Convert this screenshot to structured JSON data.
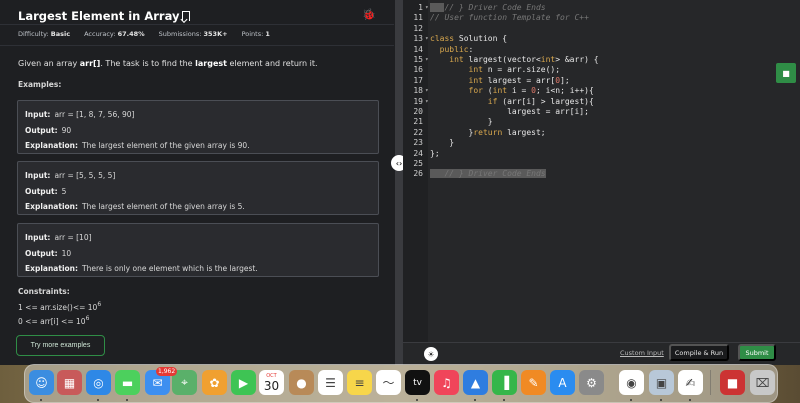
{
  "problem": {
    "title": "Largest Element in Array",
    "meta": [
      {
        "label": "Difficulty:",
        "value": "Basic"
      },
      {
        "label": "Accuracy:",
        "value": "67.48%"
      },
      {
        "label": "Submissions:",
        "value": "353K+"
      },
      {
        "label": "Points:",
        "value": "1"
      }
    ],
    "desc_pre": "Given an array ",
    "desc_arr": "arr[]",
    "desc_mid": ". The task is to find the ",
    "desc_bold": "largest",
    "desc_post": " element and return it.",
    "examples_heading": "Examples:",
    "input_label": "Input:",
    "output_label": "Output:",
    "explanation_label": "Explanation:",
    "examples": [
      {
        "input": "arr = [1, 8, 7, 56, 90]",
        "output": "90",
        "explanation": "The largest element of the given array is 90."
      },
      {
        "input": "arr = [5, 5, 5, 5]",
        "output": "5",
        "explanation": "The largest element of the given array is 5."
      },
      {
        "input": "arr = [10]",
        "output": "10",
        "explanation": "There is only one element which is the largest."
      }
    ],
    "constraints_heading": "Constraints:",
    "constraints": [
      {
        "text": "1 <= arr.size()<= 10",
        "sup": "6"
      },
      {
        "text": "0 <= arr[i] <= 10",
        "sup": "6"
      }
    ],
    "try_more_label": "Try more examples"
  },
  "editor": {
    "lines": [
      {
        "n": "1",
        "fold": true,
        "html": "<span class='hl'>   </span><span class='cm'>// } Driver Code Ends</span>"
      },
      {
        "n": "11",
        "fold": false,
        "html": "<span class='cm'>// User function Template for C++</span>"
      },
      {
        "n": "12",
        "fold": false,
        "html": ""
      },
      {
        "n": "13",
        "fold": true,
        "html": "<span class='kw'>class</span> Solution {"
      },
      {
        "n": "14",
        "fold": false,
        "html": "  <span class='kw'>public</span>:"
      },
      {
        "n": "15",
        "fold": true,
        "html": "    <span class='ty'>int</span> largest(vector&lt;<span class='ty'>int</span>&gt; &amp;arr) {"
      },
      {
        "n": "16",
        "fold": false,
        "html": "        <span class='ty'>int</span> n = arr.size();"
      },
      {
        "n": "17",
        "fold": false,
        "html": "        <span class='ty'>int</span> largest = arr[<span class='num'>0</span>];"
      },
      {
        "n": "18",
        "fold": true,
        "html": "        <span class='kw'>for</span> (<span class='ty'>int</span> i = <span class='num'>0</span>; i&lt;n; i++){"
      },
      {
        "n": "19",
        "fold": true,
        "html": "            <span class='kw'>if</span> (arr[i] &gt; largest){"
      },
      {
        "n": "20",
        "fold": false,
        "html": "                largest = arr[i];"
      },
      {
        "n": "21",
        "fold": false,
        "html": "            }"
      },
      {
        "n": "22",
        "fold": false,
        "html": "        }<span class='kw'>return</span> largest;"
      },
      {
        "n": "23",
        "fold": false,
        "html": "    }"
      },
      {
        "n": "24",
        "fold": false,
        "html": "};"
      },
      {
        "n": "25",
        "fold": false,
        "html": ""
      },
      {
        "n": "26",
        "fold": false,
        "html": "<span class='hl'>   </span><span class='cm hl'>// } Driver Code Ends</span>"
      }
    ],
    "custom_input_label": "Custom Input",
    "compile_label": "Compile & Run",
    "submit_label": "Submit"
  },
  "dock": {
    "mail_badge": "1,962",
    "calendar_month": "OCT",
    "calendar_day": "30",
    "tv_label": "tv",
    "apps": [
      {
        "name": "finder-icon",
        "color": "#3b8de0"
      },
      {
        "name": "launchpad-icon",
        "color": "#c85a5a"
      },
      {
        "name": "safari-icon",
        "color": "#2e88e6"
      },
      {
        "name": "messages-icon",
        "color": "#4cd05d"
      },
      {
        "name": "mail-icon",
        "color": "#3d8ff0"
      },
      {
        "name": "maps-icon",
        "color": "#5ab06a"
      },
      {
        "name": "photos-icon",
        "color": "#f0a030"
      },
      {
        "name": "facetime-icon",
        "color": "#3ec454"
      },
      {
        "name": "calendar-icon",
        "color": "#ffffff"
      },
      {
        "name": "contacts-icon",
        "color": "#b88a58"
      },
      {
        "name": "reminders-icon",
        "color": "#ffffff"
      },
      {
        "name": "notes-icon",
        "color": "#f7d64a"
      },
      {
        "name": "freeform-icon",
        "color": "#ffffff"
      },
      {
        "name": "appletv-icon",
        "color": "#111111"
      },
      {
        "name": "music-icon",
        "color": "#f0455a"
      },
      {
        "name": "keynote-icon",
        "color": "#2f7de0"
      },
      {
        "name": "numbers-icon",
        "color": "#35b64a"
      },
      {
        "name": "pages-icon",
        "color": "#f08a24"
      },
      {
        "name": "appstore-icon",
        "color": "#2a8cf0"
      },
      {
        "name": "system-settings-icon",
        "color": "#8a8a8a"
      },
      {
        "name": "chrome-icon",
        "color": "#ffffff"
      },
      {
        "name": "preview-icon",
        "color": "#b8c8d8"
      },
      {
        "name": "textedit-icon",
        "color": "#ffffff"
      },
      {
        "name": "photo-booth-icon",
        "color": "#c33"
      },
      {
        "name": "trash-icon",
        "color": "#c8c8c8"
      }
    ]
  }
}
